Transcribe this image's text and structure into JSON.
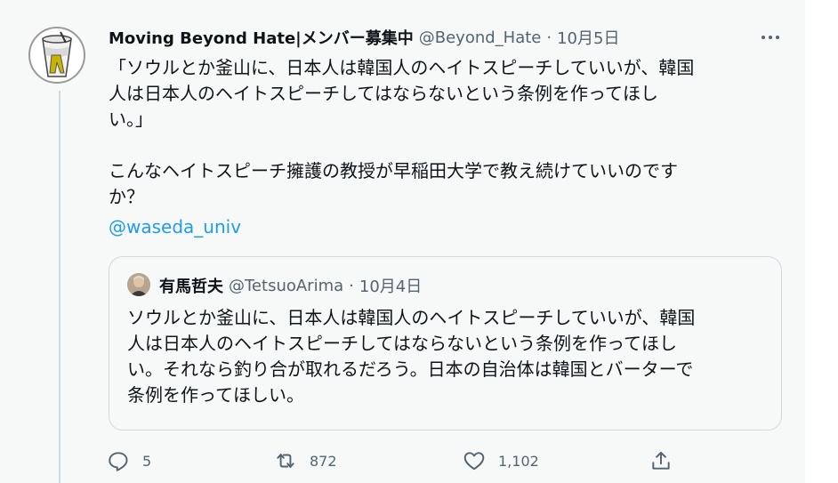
{
  "tweet": {
    "display_name": "Moving Beyond Hate|メンバー募集中",
    "handle": "@Beyond_Hate",
    "separator": "·",
    "date": "10月5日",
    "body": "「ソウルとか釜山に、日本人は韓国人のヘイトスピーチしていいが、韓国\n人は日本人のヘイトスピーチしてはならないという条例を作ってほし\nい。」\n\nこんなヘイトスピーチ擁護の教授が早稲田大学で教え続けていいのです\nか？",
    "mention": "@waseda_univ"
  },
  "quoted": {
    "display_name": "有馬哲夫",
    "handle": "@TetsuoArima",
    "separator": "·",
    "date": "10月4日",
    "body": "ソウルとか釜山に、日本人は韓国人のヘイトスピーチしていいが、韓国\n人は日本人のヘイトスピーチしてはならないという条例を作ってほし\nい。それなら釣り合が取れるだろう。日本の自治体は韓国とバーターで\n条例を作ってほしい。"
  },
  "actions": {
    "reply_count": "5",
    "retweet_count": "872",
    "like_count": "1,102"
  },
  "icons": {
    "more": "more-icon",
    "reply": "reply-icon",
    "retweet": "retweet-icon",
    "like": "heart-icon",
    "share": "share-icon"
  },
  "colors": {
    "link": "#1d9bf0",
    "secondary_text": "#536471",
    "background": "#f7f9f9"
  }
}
